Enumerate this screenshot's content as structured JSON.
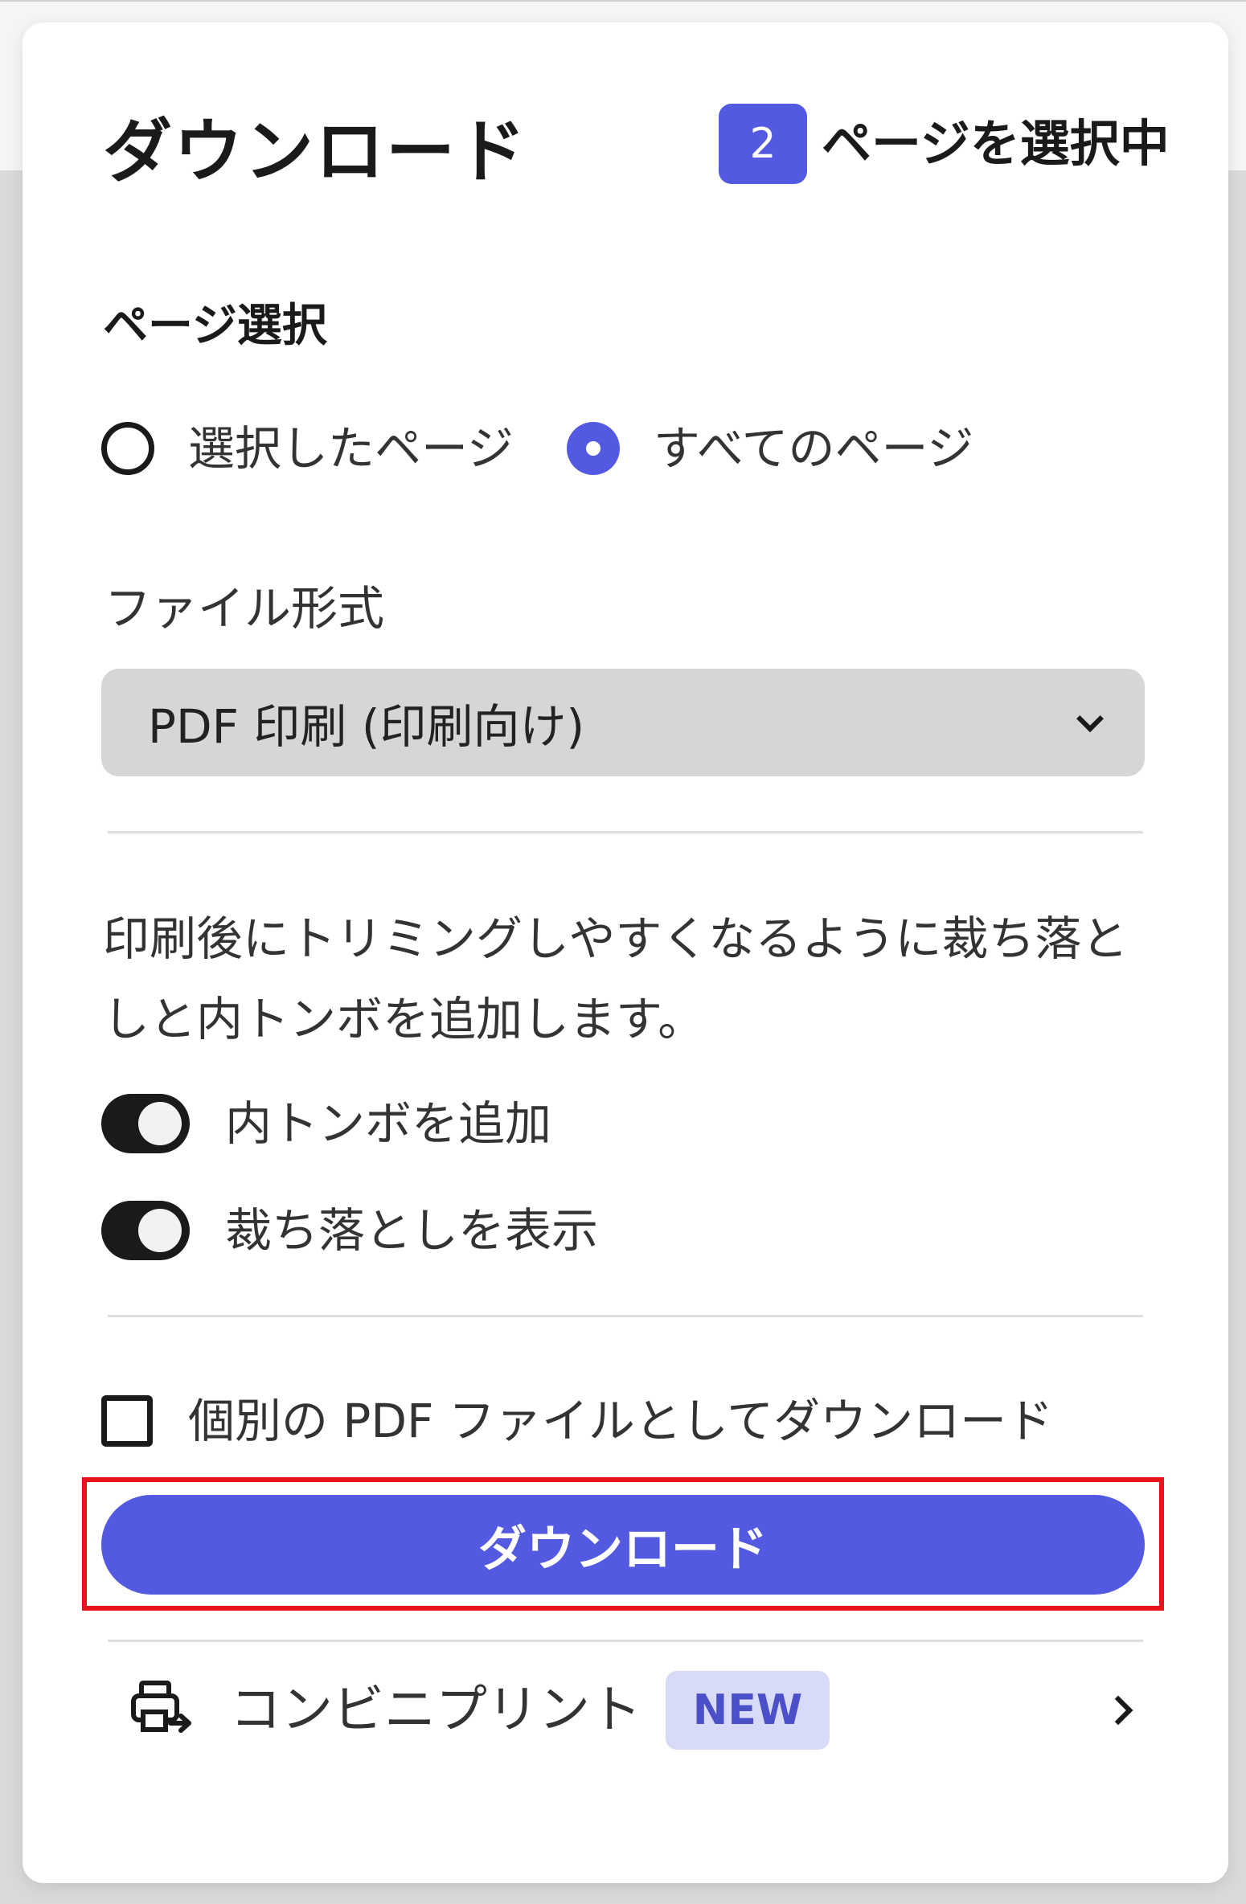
{
  "header": {
    "title": "ダウンロード",
    "selected_count": "2",
    "selected_text": "ページを選択中"
  },
  "page_selection": {
    "label": "ページ選択",
    "options": [
      {
        "label": "選択したページ",
        "checked": false
      },
      {
        "label": "すべてのページ",
        "checked": true
      }
    ]
  },
  "file_format": {
    "label": "ファイル形式",
    "selected": "PDF 印刷 (印刷向け)"
  },
  "description": "印刷後にトリミングしやすくなるように裁ち落としと内トンボを追加します。",
  "toggles": [
    {
      "label": "内トンボを追加",
      "on": true
    },
    {
      "label": "裁ち落としを表示",
      "on": true
    }
  ],
  "separate_files": {
    "label": "個別の PDF ファイルとしてダウンロード",
    "checked": false
  },
  "download_button": {
    "label": "ダウンロード"
  },
  "convenience_print": {
    "label": "コンビニプリント",
    "badge": "NEW"
  },
  "colors": {
    "accent": "#5359e0",
    "highlight": "#e8141c",
    "badge_bg": "#d8dbf7",
    "toggle_on": "#1a1a1a"
  },
  "icons": {
    "print": "printer-transfer-icon",
    "chevron_down": "chevron-down-icon",
    "chevron_right": "chevron-right-icon"
  }
}
